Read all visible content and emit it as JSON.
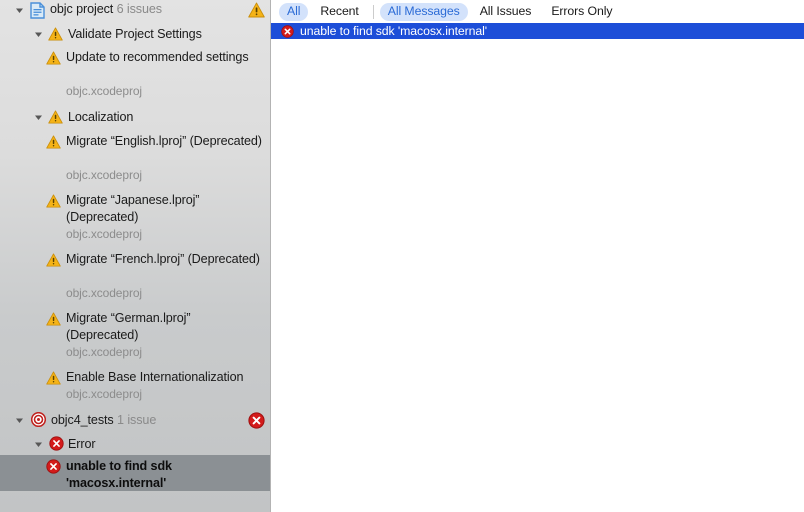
{
  "window": {
    "title": "Xcode Issue Navigator"
  },
  "sidebar": {
    "rows": [
      {
        "id": "project",
        "label": "objc project",
        "count": "6 issues",
        "icon": "project-document-icon",
        "badge": "warning-triangle-icon",
        "disclosure": "expanded",
        "depth": 0
      },
      {
        "id": "validate-project-settings",
        "label": "Validate Project Settings",
        "icon": "warning-triangle-icon",
        "disclosure": "expanded",
        "depth": 1
      },
      {
        "id": "update-recommended-settings",
        "label": "Update to recommended settings",
        "sub": "objc.xcodeproj",
        "icon": "warning-triangle-icon",
        "depth": 2
      },
      {
        "id": "localization",
        "label": "Localization",
        "icon": "warning-triangle-icon",
        "disclosure": "expanded",
        "depth": 1
      },
      {
        "id": "migrate-english",
        "label": "Migrate “English.lproj” (Deprecated)",
        "sub": "objc.xcodeproj",
        "icon": "warning-triangle-icon",
        "depth": 2
      },
      {
        "id": "migrate-japanese",
        "label": "Migrate “Japanese.lproj” (Deprecated)",
        "sub": "objc.xcodeproj",
        "icon": "warning-triangle-icon",
        "depth": 2
      },
      {
        "id": "migrate-french",
        "label": "Migrate “French.lproj” (Deprecated)",
        "sub": "objc.xcodeproj",
        "icon": "warning-triangle-icon",
        "depth": 2
      },
      {
        "id": "migrate-german",
        "label": "Migrate “German.lproj” (Deprecated)",
        "sub": "objc.xcodeproj",
        "icon": "warning-triangle-icon",
        "depth": 2
      },
      {
        "id": "enable-base-internationalization",
        "label": "Enable Base Internationalization",
        "sub": "objc.xcodeproj",
        "icon": "warning-triangle-icon",
        "depth": 2
      },
      {
        "id": "objc4-tests",
        "label": "objc4_tests",
        "count": "1 issue",
        "icon": "target-icon",
        "badge": "error-stop-icon",
        "disclosure": "expanded",
        "depth": 0
      },
      {
        "id": "error-group",
        "label": "Error",
        "icon": "error-stop-icon",
        "disclosure": "expanded",
        "depth": 1
      },
      {
        "id": "unable-to-find-sdk",
        "label": "unable to find sdk 'macosx.internal'",
        "icon": "error-stop-icon",
        "selected": true,
        "depth": 2
      }
    ]
  },
  "right_panel": {
    "filter_tabs": [
      {
        "id": "all",
        "label": "All",
        "active": true
      },
      {
        "id": "recent",
        "label": "Recent",
        "active": false
      }
    ],
    "scope_tabs": [
      {
        "id": "all-messages",
        "label": "All Messages",
        "active": true
      },
      {
        "id": "all-issues",
        "label": "All Issues",
        "active": false
      },
      {
        "id": "errors-only",
        "label": "Errors Only",
        "active": false
      }
    ],
    "messages": [
      {
        "id": "msg-unable-to-find-sdk",
        "icon": "error-stop-icon",
        "text": "unable to find sdk 'macosx.internal'",
        "selected": true
      }
    ]
  },
  "colors": {
    "selection_blue": "#1d4ed8",
    "selection_gray": "#8b9094",
    "warning_yellow": "#f5b317",
    "error_red": "#d31b1b",
    "accent_blue": "#2b6bd6",
    "pill_bg": "#d3e2fb",
    "sidebar_bg": "#dcdcdc",
    "subtitle_gray": "#8c8c8c"
  }
}
